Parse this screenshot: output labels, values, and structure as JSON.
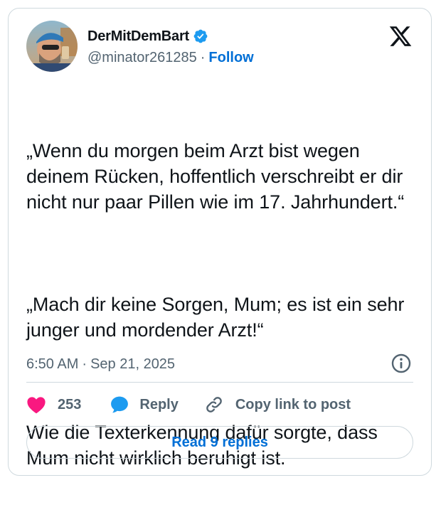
{
  "author": {
    "display_name": "DerMitDemBart",
    "handle": "@minator261285",
    "separator": "·",
    "follow_label": "Follow",
    "verified": true
  },
  "tweet": {
    "paragraphs": [
      "„Wenn du morgen beim Arzt bist wegen deinem Rücken, hoffentlich verschreibt er dir nicht nur paar Pillen wie im 17. Jahrhundert.“",
      "„Mach dir keine Sorgen, Mum; es ist ein sehr junger und mordender Arzt!“",
      "Wie die Texterkennung dafür sorgte, dass Mum nicht wirklich beruhigt ist."
    ],
    "time": "6:50 AM",
    "date_separator": "·",
    "date": "Sep 21, 2025"
  },
  "actions": {
    "like_count": "253",
    "reply_label": "Reply",
    "copy_link_label": "Copy link to post"
  },
  "footer": {
    "read_replies_label": "Read 9 replies"
  },
  "icons": {
    "logo": "x-logo-icon",
    "verified": "verified-badge-icon",
    "info": "info-icon",
    "like": "heart-icon",
    "reply": "speech-bubble-icon",
    "copy": "link-icon"
  },
  "colors": {
    "accent": "#006fd6",
    "verified": "#1d9bf0",
    "heart": "#f91880",
    "text": "#0f1419",
    "muted": "#536471",
    "border": "#cfd9de"
  }
}
